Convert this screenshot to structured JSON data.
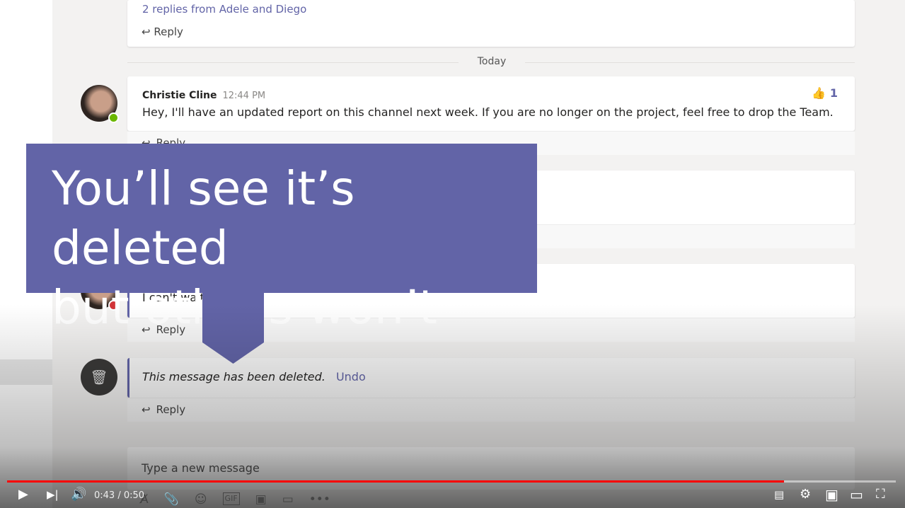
{
  "thread_prev": {
    "replies_link": "2 replies from Adele and Diego",
    "reply": "Reply"
  },
  "divider": "Today",
  "messages": [
    {
      "author": "Christie Cline",
      "time": "12:44 PM",
      "text": "Hey, I'll have an updated report on this channel next week. If you are no longer on the project, feel free to drop the Team.",
      "reaction_icon": "👍",
      "reaction_count": "1",
      "reply": "Reply"
    },
    {
      "text": "I can't wait report.",
      "reply": "Reply"
    },
    {
      "deleted_text": "This message has been deleted.",
      "undo": "Undo",
      "reply": "Reply"
    }
  ],
  "overlay": {
    "line1": "You’ll see it’s deleted",
    "line2": "but others won’t"
  },
  "compose": {
    "placeholder": "Type a new message"
  },
  "player": {
    "time": "0:43 / 0:50",
    "progress": 0.874,
    "accent": "#ff0000"
  },
  "colors": {
    "teams_purple": "#6264a7"
  }
}
